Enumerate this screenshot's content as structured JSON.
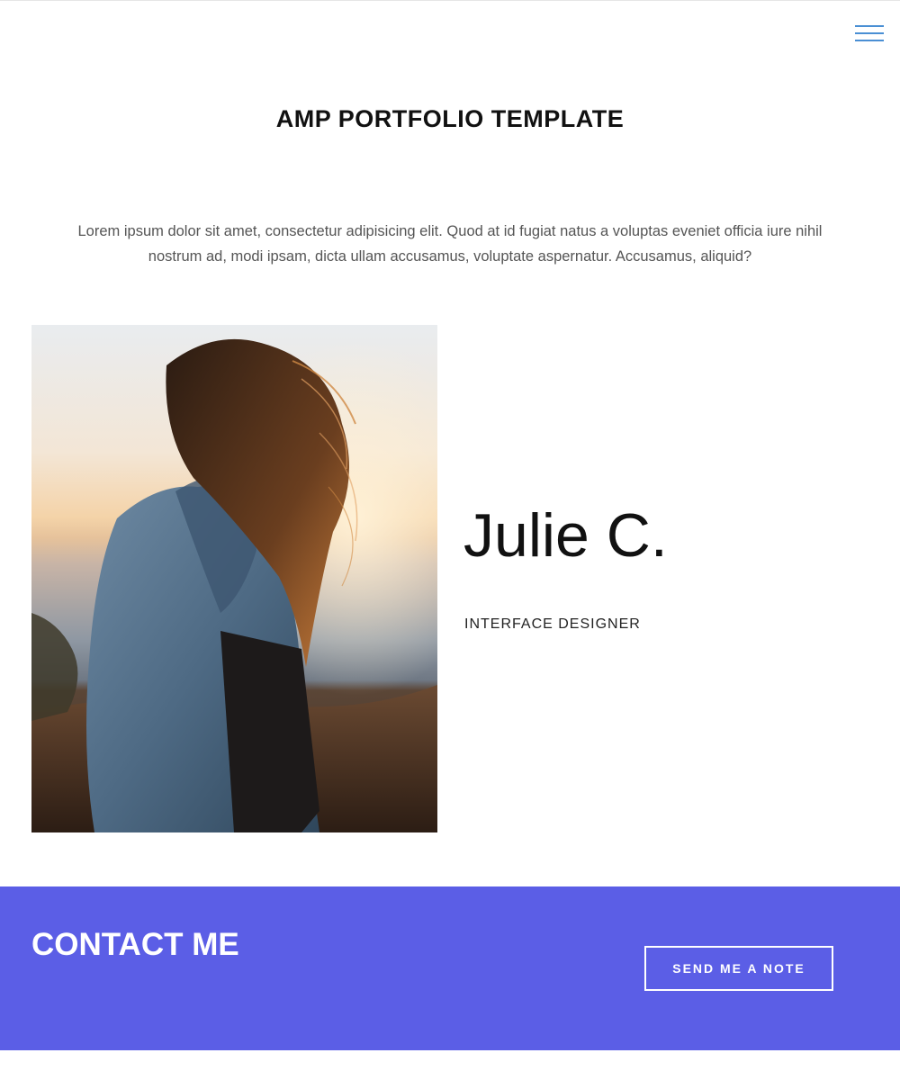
{
  "header": {
    "menu_icon": "hamburger-menu-icon",
    "accent_color": "#4a8fd4"
  },
  "hero": {
    "title": "AMP PORTFOLIO TEMPLATE",
    "intro": "Lorem ipsum dolor sit amet, consectetur adipisicing elit. Quod at id fugiat natus a voluptas eveniet officia iure nihil nostrum ad, modi ipsam, dicta ullam accusamus, voluptate aspernatur. Accusamus, aliquid?"
  },
  "profile": {
    "name": "Julie C.",
    "role": "INTERFACE DESIGNER"
  },
  "contact": {
    "title": "CONTACT ME",
    "button_label": "SEND ME A NOTE",
    "band_color": "#5b5ee6"
  }
}
